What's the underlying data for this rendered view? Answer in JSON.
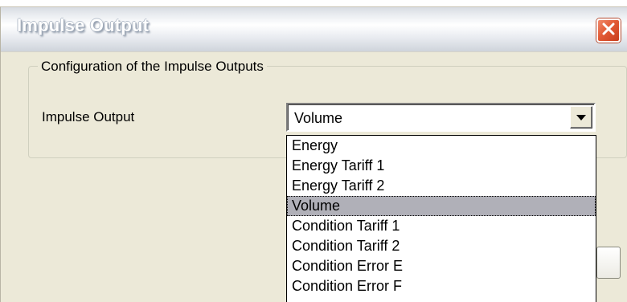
{
  "window": {
    "title": "Impulse Output"
  },
  "group": {
    "label": "Configuration of the Impulse Outputs"
  },
  "field": {
    "label": "Impulse Output",
    "selected_value": "Volume"
  },
  "dropdown": {
    "items": [
      "Energy",
      "Energy Tariff 1",
      "Energy Tariff 2",
      "Volume",
      "Condition Tariff 1",
      "Condition Tariff 2",
      "Condition Error E",
      "Condition Error F"
    ],
    "selected_index": 3
  },
  "colors": {
    "close_button": "#e25a35",
    "selection": "#b0b0b8",
    "dialog_background": "#ece9d8"
  }
}
